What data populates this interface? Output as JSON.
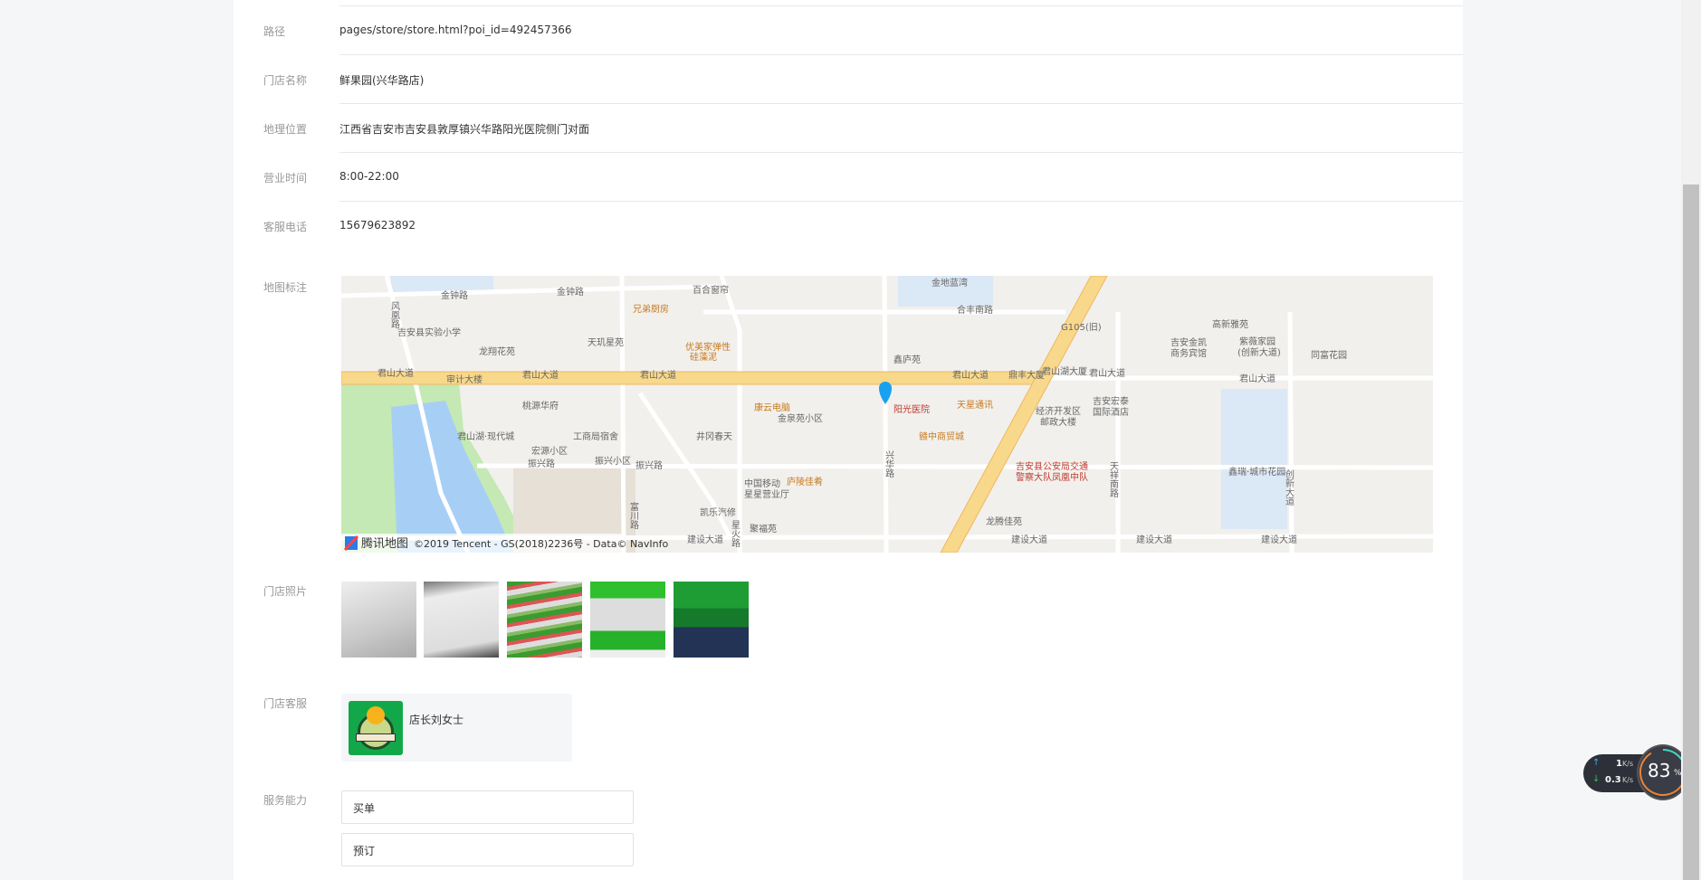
{
  "fields": [
    {
      "label": "路径",
      "value": "pages/store/store.html?poi_id=492457366"
    },
    {
      "label": "门店名称",
      "value": "鲜果园(兴华路店)"
    },
    {
      "label": "地理位置",
      "value": "江西省吉安市吉安县敦厚镇兴华路阳光医院侧门对面"
    },
    {
      "label": "营业时间",
      "value": "8:00-22:00"
    },
    {
      "label": "客服电话",
      "value": "15679623892"
    }
  ],
  "map_label": "地图标注",
  "map": {
    "brand": "腾讯地图",
    "copyright": "©2019 Tencent - GS(2018)2236号 - Data© NavInfo",
    "labels": [
      "金钟路",
      "金钟路",
      "风凰路",
      "吉安县实验小学",
      "龙翔花苑",
      "天玑星苑",
      "兄弟厨房",
      "百合窗帘",
      "优美家弹性",
      "硅藻泥",
      "君山大道",
      "君山大道",
      "君山大道",
      "审计大楼",
      "桃源华府",
      "君山湖·现代城",
      "宏源小区",
      "工商局宿舍",
      "振兴小区",
      "振兴路",
      "振兴路",
      "井冈春天",
      "康云电脑",
      "金泉苑小区",
      "中国移动",
      "星星营业厅",
      "凯乐汽修",
      "聚福苑",
      "建设大道",
      "庐陵佳肴",
      "金地蓝湾",
      "合丰南路",
      "鑫庐苑",
      "阳光医院",
      "天星通讯",
      "赣中商贸城",
      "鼎丰大厦",
      "君山湖大厦",
      "君山大道",
      "君山大道",
      "君山大道",
      "经济开发区",
      "邮政大楼",
      "吉安宏泰",
      "国际酒店",
      "吉安金凯",
      "商务宾馆",
      "高新雅苑",
      "紫薇家园",
      "(创新大道)",
      "同富花园",
      "吉安县公安局交通",
      "警察大队凤凰中队",
      "龙腾佳苑",
      "建设大道",
      "建设大道",
      "建设大道",
      "鑫瑞·城市花园",
      "天祥南路",
      "创新大道",
      "兴华路",
      "富川路",
      "星火路",
      "G105(旧)"
    ]
  },
  "photos_label": "门店照片",
  "service_label": "门店客服",
  "service": {
    "name": "店长刘女士"
  },
  "capability_label": "服务能力",
  "capabilities": [
    "买单",
    "预订"
  ],
  "net_widget": {
    "up": "1",
    "up_unit": "K/s",
    "down": "0.3",
    "down_unit": "K/s",
    "percent": "83",
    "percent_sign": "%"
  }
}
